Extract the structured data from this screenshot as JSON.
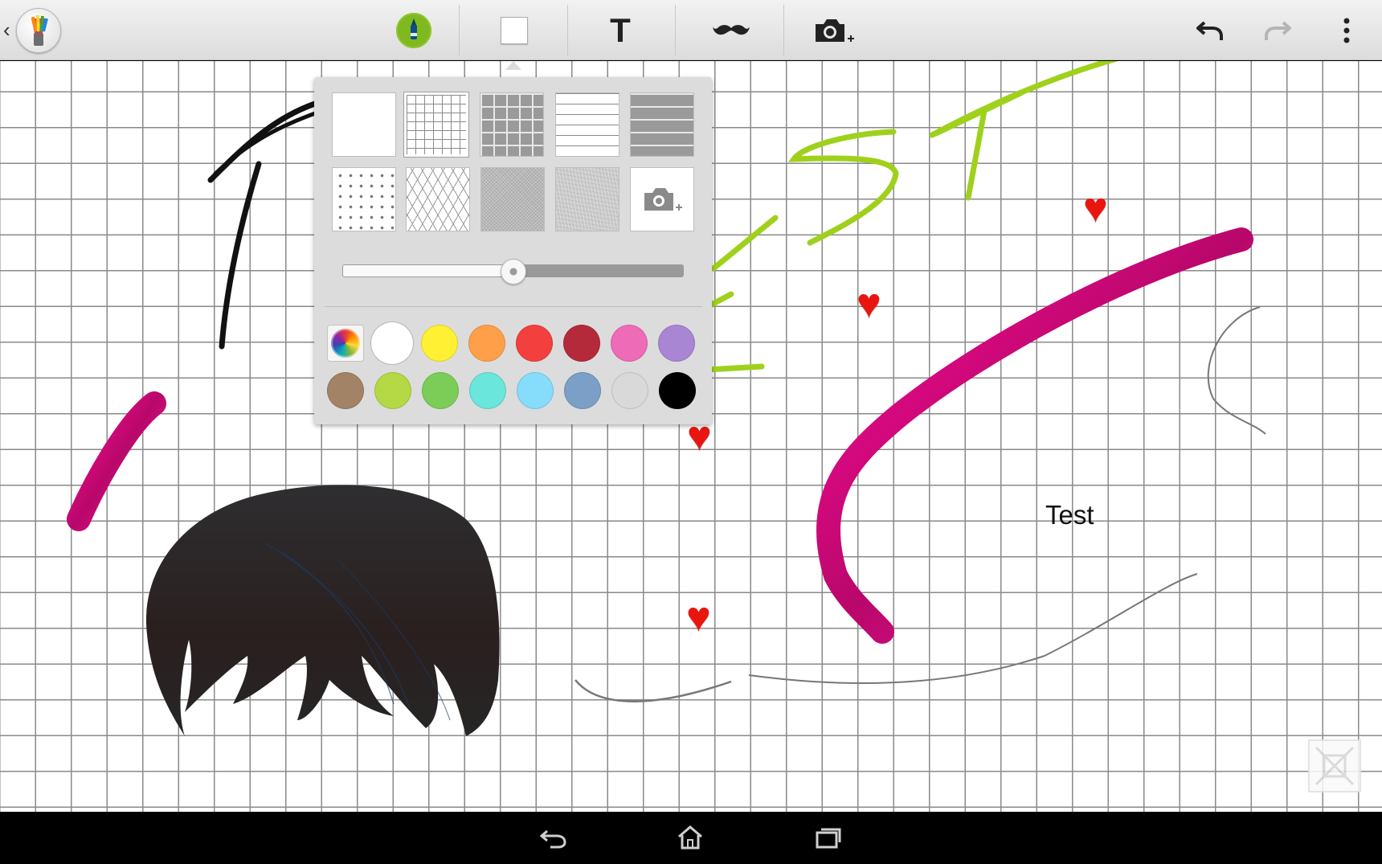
{
  "toolbar": {
    "back": "‹",
    "tools": [
      {
        "name": "pen-tool",
        "icon": "marker-pen-icon",
        "accent": "#7fb81f"
      },
      {
        "name": "background-tool",
        "icon": "background-square-icon"
      },
      {
        "name": "text-tool",
        "icon": "text-T-icon",
        "label": "T"
      },
      {
        "name": "stamp-tool",
        "icon": "mustache-icon"
      },
      {
        "name": "camera-tool",
        "icon": "camera-add-icon"
      }
    ],
    "undo": "undo-icon",
    "redo": "redo-icon",
    "menu": "overflow-menu-icon"
  },
  "background_popup": {
    "patterns": [
      "plain",
      "grid-fine",
      "grid-bold",
      "lines-thin",
      "lines-bold",
      "dots",
      "isometric",
      "canvas-texture",
      "paper-texture",
      "add-photo"
    ],
    "selected_pattern": "grid-fine",
    "slider_value": 0.5,
    "colors": {
      "row1": [
        "#ffffff",
        "#fff033",
        "#ff9f4a",
        "#f43f3f",
        "#b52a3a",
        "#ee6bb8",
        "#a886d4"
      ],
      "row2": [
        "#a38365",
        "#b5d845",
        "#7ccd58",
        "#6ae6dc",
        "#85dcfb",
        "#7b9fc6",
        "#d9d9d9",
        "#000000"
      ]
    },
    "selected_color": "#ffffff"
  },
  "canvas": {
    "text_note": "Test",
    "stroke_colors": {
      "green": "#9fd11c",
      "magenta": "#e8108f",
      "black": "#111111",
      "gray": "#777777"
    }
  },
  "navbar": {
    "buttons": [
      "back-icon",
      "home-icon",
      "recent-apps-icon"
    ]
  }
}
